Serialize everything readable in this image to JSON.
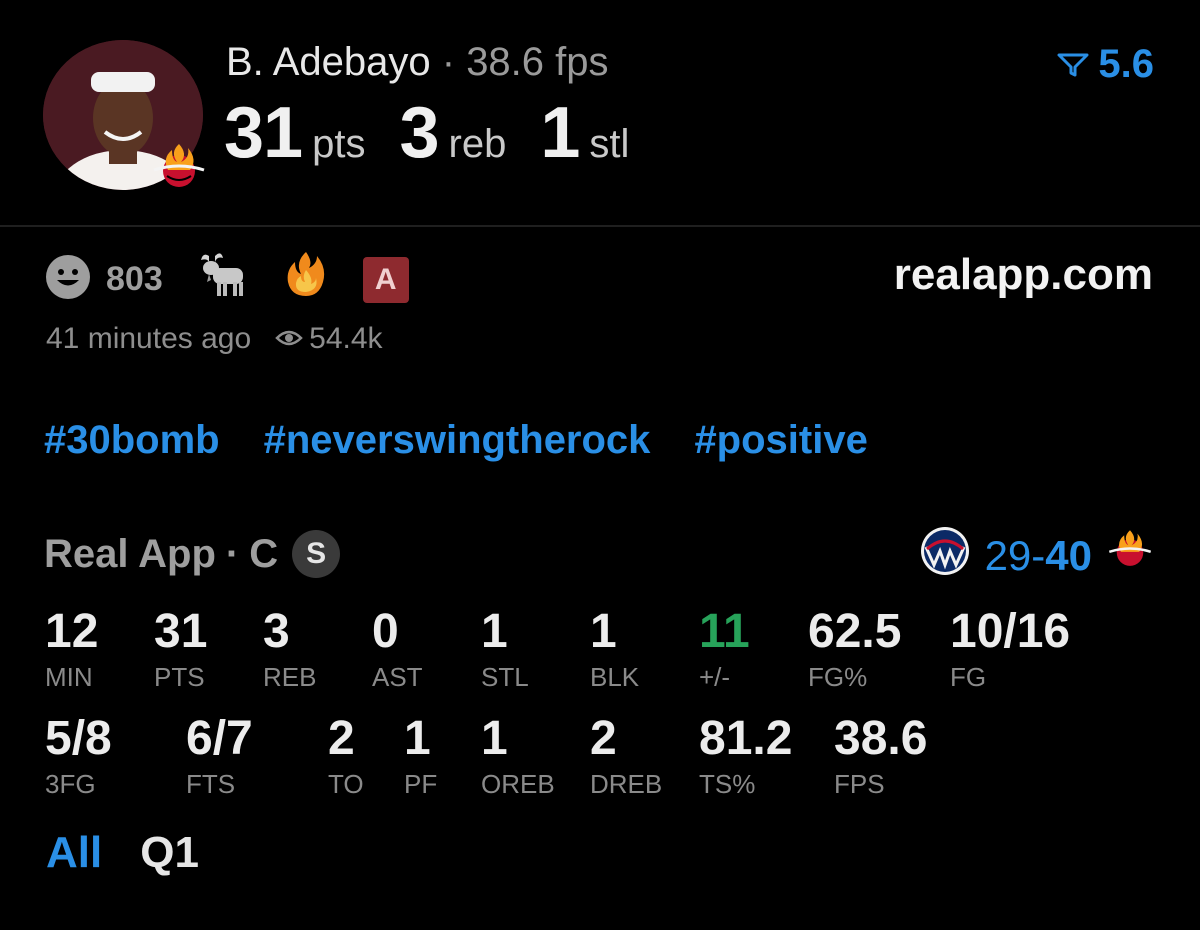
{
  "player": {
    "name": "B. Adebayo",
    "separator": "·",
    "fps": "38.6 fps",
    "avatar_icon": "player-avatar",
    "team_icon": "miami-heat-logo"
  },
  "headline_stats": [
    {
      "value": "31",
      "unit": "pts"
    },
    {
      "value": "3",
      "unit": "reb"
    },
    {
      "value": "1",
      "unit": "stl"
    }
  ],
  "filter": {
    "icon": "funnel-icon",
    "value": "5.6"
  },
  "reactions": {
    "count": "803",
    "smiley_icon": "smiley-icon",
    "goat_icon": "goat-icon",
    "fire_icon": "fire-icon",
    "badge_letter": "A"
  },
  "site": "realapp.com",
  "meta": {
    "time_ago": "41 minutes ago",
    "views": "54.4k"
  },
  "hashtags": [
    "#30bomb",
    "#neverswingtherock",
    "#positive"
  ],
  "game": {
    "source": "Real App",
    "separator": "·",
    "position": "C",
    "status_badge": "S",
    "away_icon": "wizards-logo",
    "home_icon": "miami-heat-logo",
    "score_away": "29",
    "score_dash": "-",
    "score_home": "40"
  },
  "stats_row1": [
    {
      "value": "12",
      "label": "MIN"
    },
    {
      "value": "31",
      "label": "PTS"
    },
    {
      "value": "3",
      "label": "REB"
    },
    {
      "value": "0",
      "label": "AST"
    },
    {
      "value": "1",
      "label": "STL"
    },
    {
      "value": "1",
      "label": "BLK"
    },
    {
      "value": "11",
      "label": "+/-"
    },
    {
      "value": "62.5",
      "label": "FG%"
    },
    {
      "value": "10/16",
      "label": "FG"
    }
  ],
  "stats_row2": [
    {
      "value": "5/8",
      "label": "3FG"
    },
    {
      "value": "6/7",
      "label": "FTS"
    },
    {
      "value": "2",
      "label": "TO"
    },
    {
      "value": "1",
      "label": "PF"
    },
    {
      "value": "1",
      "label": "OREB"
    },
    {
      "value": "2",
      "label": "DREB"
    },
    {
      "value": "81.2",
      "label": "TS%"
    },
    {
      "value": "38.6",
      "label": "FPS"
    }
  ],
  "tabs": [
    {
      "label": "All",
      "active": true
    },
    {
      "label": "Q1",
      "active": false
    }
  ],
  "colors": {
    "accent": "#2a8fe6",
    "positive": "#27a35a",
    "badge": "#8e2a2f"
  }
}
